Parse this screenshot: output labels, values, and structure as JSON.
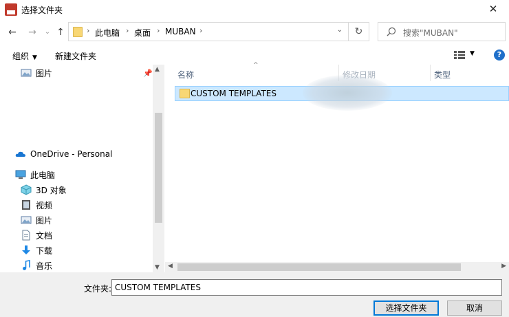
{
  "window": {
    "title": "选择文件夹",
    "close": "✕"
  },
  "nav": {
    "back": "←",
    "forward": "→",
    "recent": "⌄",
    "up": "↑",
    "breadcrumbs": [
      "此电脑",
      "桌面",
      "MUBAN"
    ],
    "sep": "›",
    "dropdown": "⌄",
    "refresh": "↻",
    "search_placeholder": "搜索\"MUBAN\""
  },
  "toolbar": {
    "organize": "组织",
    "new_folder": "新建文件夹",
    "dd": "▼"
  },
  "sidebar": {
    "pictures_top": "图片",
    "onedrive": "OneDrive - Personal",
    "thispc": "此电脑",
    "objects3d": "3D 对象",
    "videos": "视频",
    "pictures": "图片",
    "documents": "文档",
    "downloads": "下载",
    "music": "音乐"
  },
  "columns": {
    "name": "名称",
    "modified": "修改日期",
    "type": "类型",
    "sort": "^"
  },
  "files": [
    {
      "name": "CUSTOM TEMPLATES"
    }
  ],
  "footer": {
    "folder_label": "文件夹:",
    "folder_value": "CUSTOM TEMPLATES",
    "select_button": "选择文件夹",
    "cancel_button": "取消"
  }
}
